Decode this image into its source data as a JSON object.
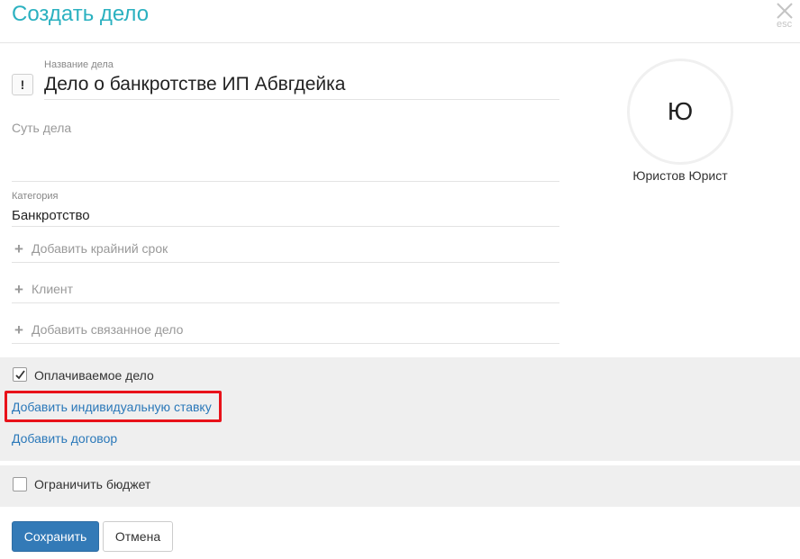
{
  "modal": {
    "title": "Создать дело",
    "close_hint": "esc"
  },
  "form": {
    "case_name_label": "Название дела",
    "case_name_value": "Дело о банкротстве ИП Абвгдейка",
    "flag_symbol": "!",
    "essence_placeholder": "Суть дела",
    "category_label": "Категория",
    "category_value": "Банкротство",
    "add_rows": [
      {
        "label": "Добавить крайний срок",
        "icon": "plus-icon"
      },
      {
        "label": "Клиент",
        "icon": "plus-icon"
      },
      {
        "label": "Добавить связанное дело",
        "icon": "plus-icon"
      }
    ]
  },
  "responsible": {
    "initial": "Ю",
    "name": "Юристов Юрист"
  },
  "billing": {
    "paid_case_label": "Оплачиваемое дело",
    "paid_case_checked": true,
    "add_individual_rate": "Добавить индивидуальную ставку",
    "add_contract": "Добавить договор"
  },
  "budget": {
    "limit_label": "Ограничить бюджет",
    "limit_checked": false
  },
  "actions": {
    "save": "Сохранить",
    "cancel": "Отмена"
  },
  "colors": {
    "title": "#2bb1c0",
    "link": "#2a78b9",
    "primary": "#337ab7",
    "highlight": "#e8121a",
    "section_bg": "#efefef"
  }
}
